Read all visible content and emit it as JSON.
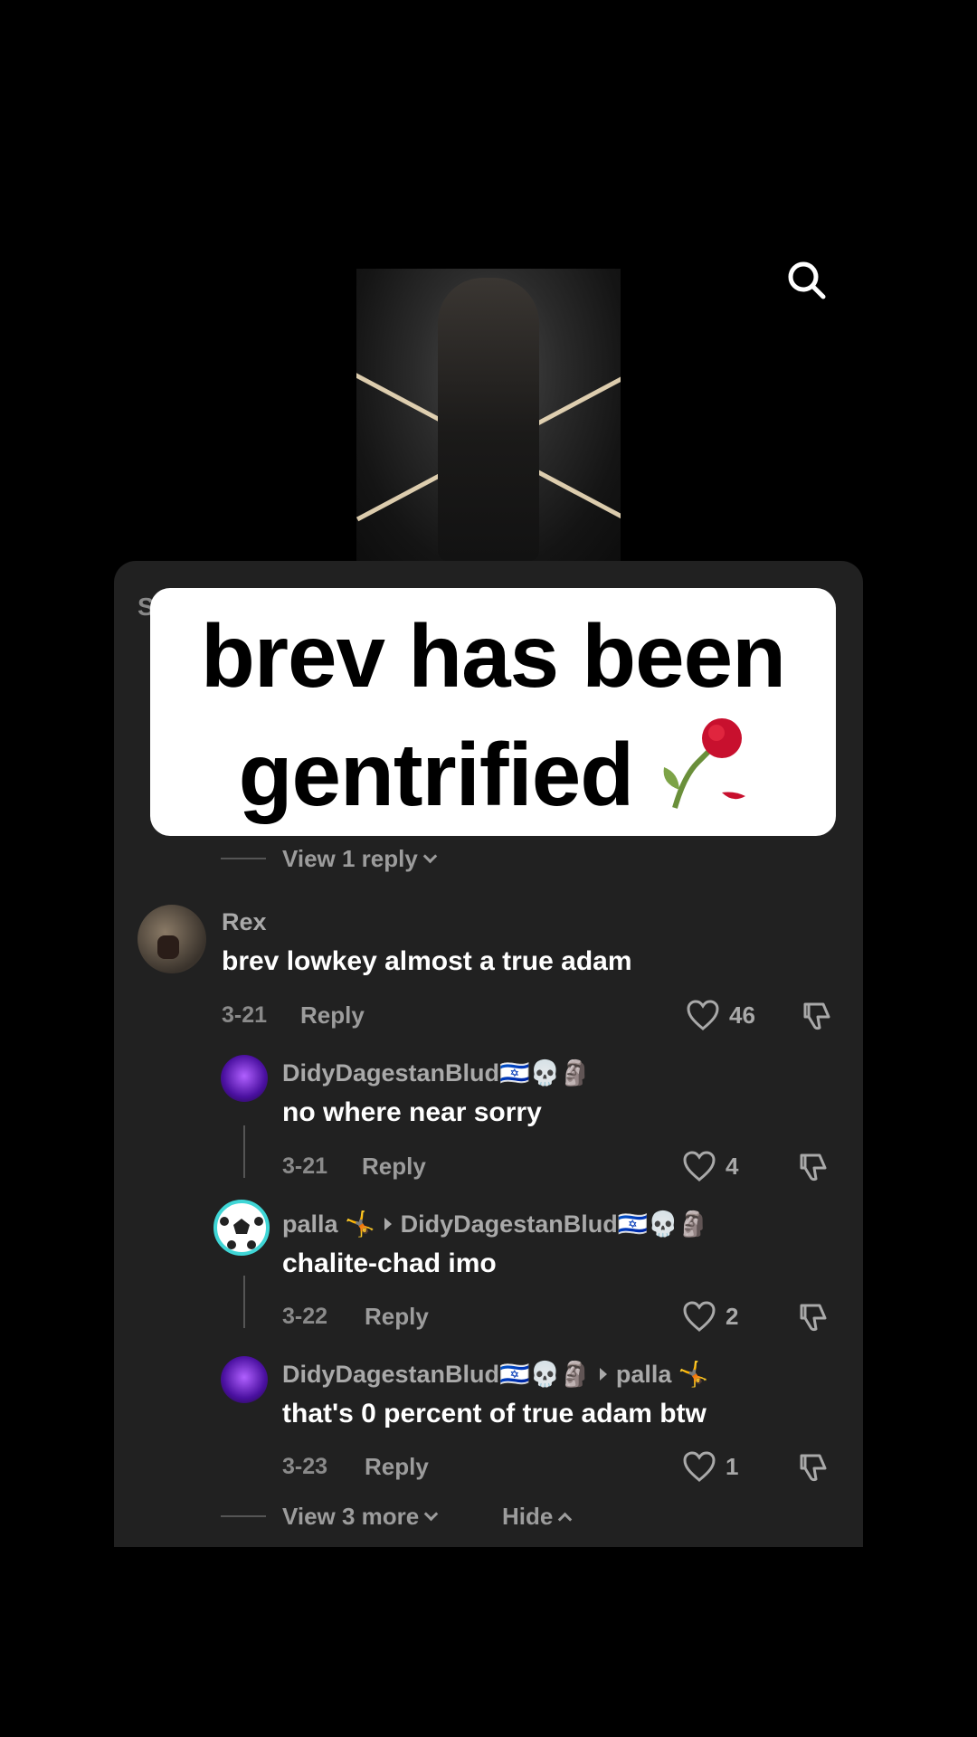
{
  "caption": {
    "text": "brev has been gentrified"
  },
  "panel": {
    "header_stub": "S"
  },
  "thread": {
    "view_replies_label": "View 1 reply",
    "comment": {
      "username": "Rex",
      "text": "brev lowkey almost a true adam",
      "date": "3-21",
      "reply_label": "Reply",
      "likes": "46"
    },
    "replies": [
      {
        "username": "DidyDagestanBlud🇮🇱💀🗿",
        "text": "no where near sorry",
        "date": "3-21",
        "reply_label": "Reply",
        "likes": "4"
      },
      {
        "username": "palla 🤸",
        "reply_to": "DidyDagestanBlud🇮🇱💀🗿",
        "text": "chalite-chad imo",
        "date": "3-22",
        "reply_label": "Reply",
        "likes": "2"
      },
      {
        "username": "DidyDagestanBlud🇮🇱💀🗿",
        "reply_to": "palla 🤸",
        "text": "that's 0 percent of true adam btw",
        "date": "3-23",
        "reply_label": "Reply",
        "likes": "1"
      }
    ],
    "view_more_label": "View 3 more",
    "hide_label": "Hide"
  },
  "colors": {
    "panel_bg": "#212121",
    "accent_ring": "#3fd6d6",
    "avatar_purple": "#7b2cff"
  }
}
